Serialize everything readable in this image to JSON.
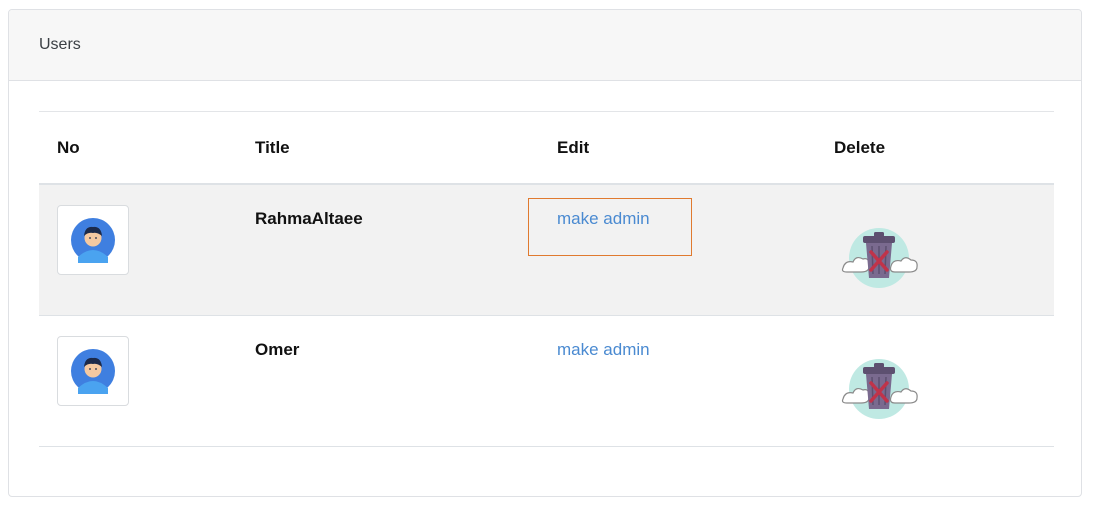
{
  "card": {
    "header": "Users"
  },
  "table": {
    "columns": {
      "no": "No",
      "title": "Title",
      "edit": "Edit",
      "delete": "Delete"
    },
    "rows": [
      {
        "name": "RahmaAltaee",
        "action": "make admin",
        "avatar_icon": "user-avatar-icon",
        "delete_icon": "trash-delete-icon"
      },
      {
        "name": "Omer",
        "action": "make admin",
        "avatar_icon": "user-avatar-icon",
        "delete_icon": "trash-delete-icon"
      }
    ]
  },
  "colors": {
    "link": "#4a8ad1",
    "highlight": "#e07a2f",
    "avatar_bg": "#3f7fe0",
    "trash": "#7a6a8f",
    "cross": "#c0334a"
  }
}
